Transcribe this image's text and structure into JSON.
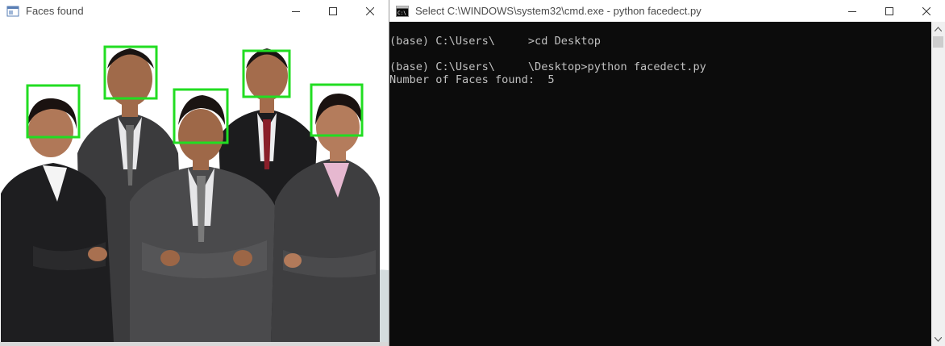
{
  "left_window": {
    "title": "Faces found",
    "icon": "opencv-window-icon",
    "controls": [
      "minimize-icon",
      "maximize-icon",
      "close-icon"
    ],
    "face_boxes": {
      "count": 5,
      "color": "#22dd22"
    }
  },
  "right_window": {
    "title": "Select C:\\WINDOWS\\system32\\cmd.exe - python  facedect.py",
    "icon": "cmd-icon",
    "controls": [
      "minimize-icon",
      "maximize-icon",
      "close-icon"
    ],
    "console": {
      "line1": "(base) C:\\Users\\     >cd Desktop",
      "line2": "(base) C:\\Users\\     \\Desktop>python facedect.py",
      "line3": "Number of Faces found:  5"
    }
  },
  "colors": {
    "console_bg": "#0c0c0c",
    "console_text": "#c0c0c0",
    "face_box": "#22dd22",
    "suit_gray": "#4a4a4c",
    "suit_dark": "#1c1c1e"
  }
}
